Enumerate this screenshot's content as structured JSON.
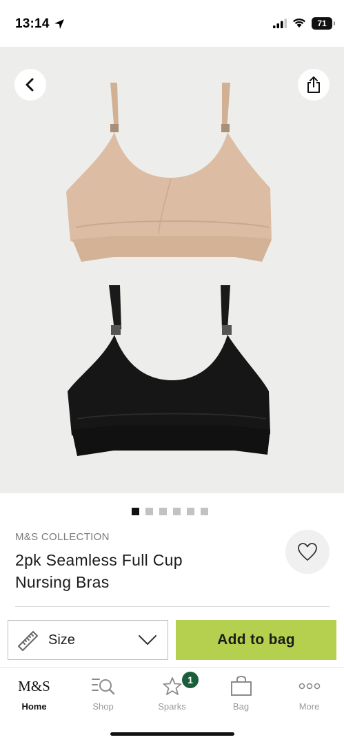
{
  "status_bar": {
    "time": "13:14",
    "battery": "71"
  },
  "product": {
    "brand": "M&S COLLECTION",
    "title": "2pk Seamless Full Cup Nursing Bras",
    "image_count": 6,
    "active_image": 1,
    "colors": {
      "nude": "#d8b79c",
      "black": "#141414"
    }
  },
  "actions": {
    "size_label": "Size",
    "add_to_bag_label": "Add to bag",
    "add_to_bag_color": "#b5cf4e"
  },
  "tabbar": {
    "items": [
      {
        "label": "Home",
        "icon": "ms-logo",
        "logo_text": "M&S",
        "active": true
      },
      {
        "label": "Shop",
        "icon": "shop-search-icon",
        "active": false
      },
      {
        "label": "Sparks",
        "icon": "sparks-star-icon",
        "active": false,
        "badge": "1"
      },
      {
        "label": "Bag",
        "icon": "bag-icon",
        "active": false
      },
      {
        "label": "More",
        "icon": "more-dots-icon",
        "active": false
      }
    ]
  }
}
